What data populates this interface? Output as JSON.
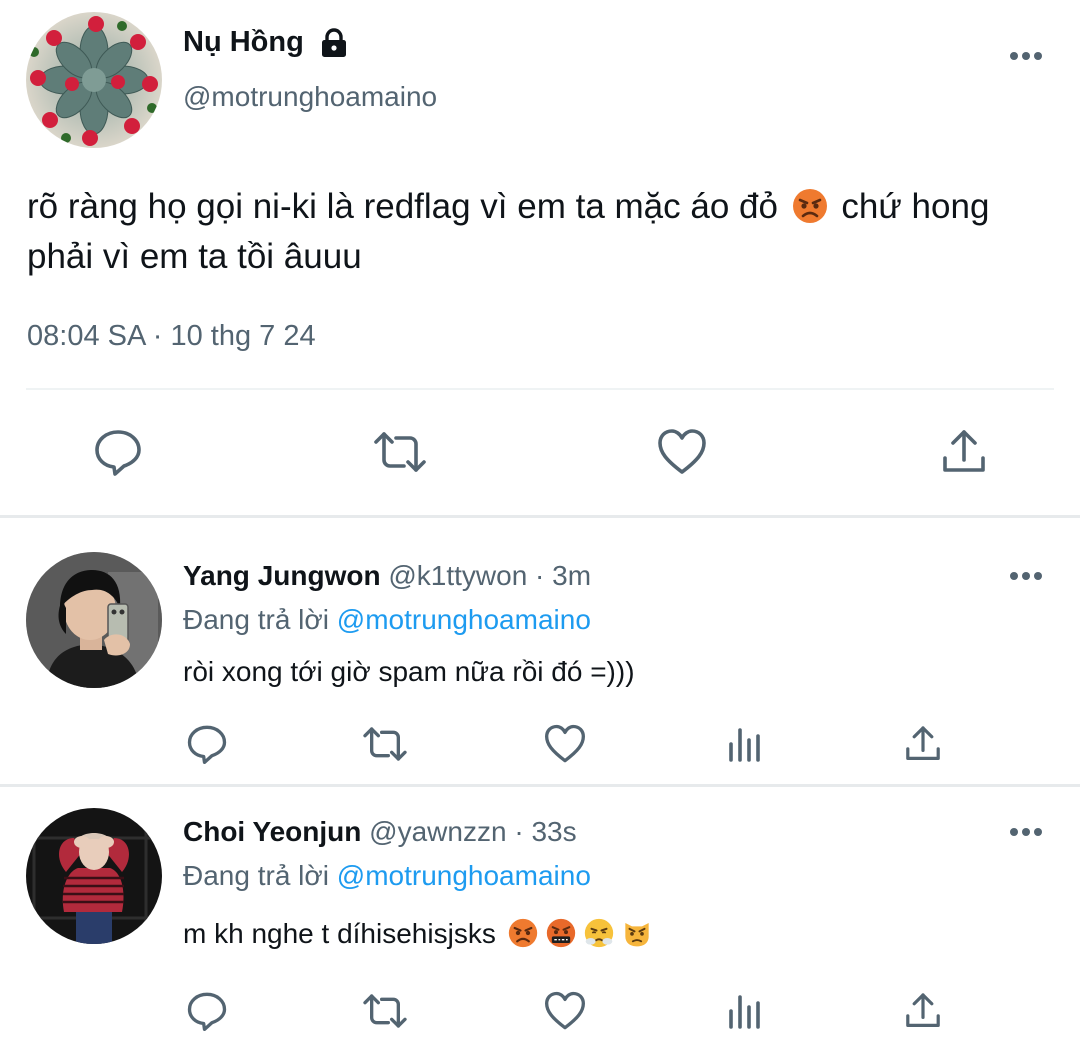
{
  "main_tweet": {
    "display_name": "Nụ Hồng",
    "handle": "@motrunghoamaino",
    "text_before_emoji": "rõ ràng họ gọi ni-ki là redflag vì em ta mặc áo đỏ",
    "text_after_emoji": "chứ hong phải vì em ta tồi âuuu",
    "emoji": "angry-face",
    "timestamp": "08:04 SA · 10 thg 7 24",
    "protected": true
  },
  "replies": [
    {
      "display_name": "Yang Jungwon",
      "handle": "@k1ttywon",
      "time": "3m",
      "replying_label": "Đang trả lời",
      "replying_to": "@motrunghoamaino",
      "text": "ròi xong tới giờ spam nữa rồi đó =)))",
      "emojis": []
    },
    {
      "display_name": "Choi Yeonjun",
      "handle": "@yawnzzn",
      "time": "33s",
      "replying_label": "Đang trả lời",
      "replying_to": "@motrunghoamaino",
      "text": "m kh nghe t díhisehisjsks",
      "emojis": [
        "angry-face",
        "cursing-face",
        "steam-nose-face",
        "pouting-cat-face"
      ]
    }
  ],
  "separator": "·",
  "colors": {
    "text_primary": "#0f1419",
    "text_secondary": "#536471",
    "mention": "#1d9bf0",
    "divider": "#eff3f4"
  }
}
